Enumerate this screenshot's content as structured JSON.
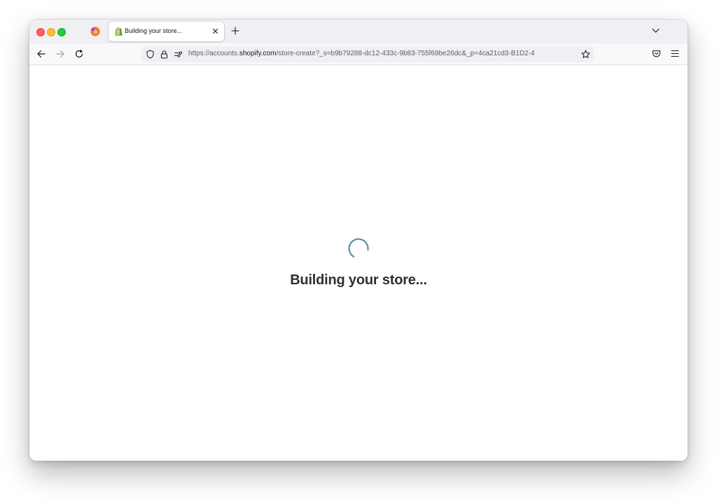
{
  "browser": {
    "tab": {
      "title": "Building your store...",
      "favicon": "shopify-bag-icon"
    },
    "url": {
      "prefix": "https://accounts.",
      "domain": "shopify.com",
      "path": "/store-create?_s=b9b79288-dc12-433c-9b83-755f69be26dc&_p=4ca21cd3-B1D2-4"
    },
    "icons": [
      "firefox-icon",
      "close-icon",
      "plus-icon",
      "chevron-down-icon",
      "back-arrow-icon",
      "forward-arrow-icon",
      "reload-icon",
      "shield-icon",
      "lock-icon",
      "permissions-icon",
      "star-icon",
      "pocket-icon",
      "hamburger-menu-icon"
    ]
  },
  "page": {
    "status_text": "Building your store...",
    "spinner_color": "#5e8ea0"
  },
  "colors": {
    "traffic_red": "#ff5f57",
    "traffic_yellow": "#febc2e",
    "traffic_green": "#28c840",
    "shopify_green": "#95bf47"
  }
}
